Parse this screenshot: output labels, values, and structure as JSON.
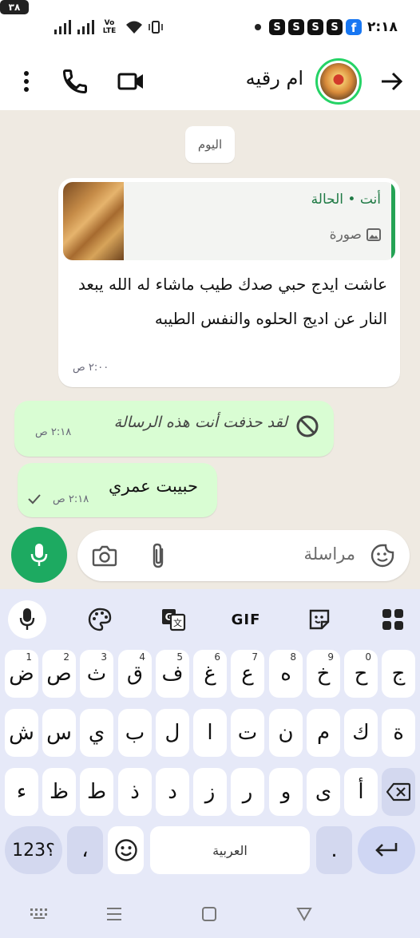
{
  "status_bar": {
    "battery": "٣٨",
    "network": "Vo LTE",
    "app_badges": [
      "S",
      "S",
      "S",
      "S"
    ],
    "facebook_badge": "f",
    "time": "٢:١٨"
  },
  "header": {
    "contact_name": "ام رقيه",
    "icons": [
      "back-arrow-icon",
      "video-call-icon",
      "voice-call-icon",
      "more-options-icon"
    ]
  },
  "chat": {
    "date_chip": "اليوم",
    "incoming": {
      "quote_title": "أنت • الحالة",
      "quote_subtitle": "صورة",
      "text": "عاشت ايدج حبي صدك طيب ماشاء له الله يبعد النار عن اديج الحلوه والنفس الطيبه",
      "time": "٢:٠٠ ص"
    },
    "deleted": {
      "text": "لقد حذفت أنت هذه الرسالة",
      "time": "٢:١٨ ص"
    },
    "outgoing": {
      "text": "حبيبت عمري",
      "time": "٢:١٨ ص"
    }
  },
  "composer": {
    "placeholder": "مراسلة"
  },
  "keyboard": {
    "toolbar": [
      "mic-icon",
      "palette-icon",
      "translate-icon",
      "GIF",
      "sticker-icon",
      "apps-grid-icon"
    ],
    "row1": [
      {
        "ch": "ض",
        "num": "1"
      },
      {
        "ch": "ص",
        "num": "2"
      },
      {
        "ch": "ث",
        "num": "3"
      },
      {
        "ch": "ق",
        "num": "4"
      },
      {
        "ch": "ف",
        "num": "5"
      },
      {
        "ch": "غ",
        "num": "6"
      },
      {
        "ch": "ع",
        "num": "7"
      },
      {
        "ch": "ه",
        "num": "8"
      },
      {
        "ch": "خ",
        "num": "9"
      },
      {
        "ch": "ح",
        "num": "0"
      },
      {
        "ch": "ج",
        "num": ""
      }
    ],
    "row2": [
      "ش",
      "س",
      "ي",
      "ب",
      "ل",
      "ا",
      "ت",
      "ن",
      "م",
      "ك",
      "ة"
    ],
    "row3": [
      "ء",
      "ظ",
      "ط",
      "ذ",
      "د",
      "ز",
      "ر",
      "و",
      "ى",
      "أ"
    ],
    "symbols_label": "؟123",
    "comma_label": "،",
    "space_label": "العربية",
    "period_label": "."
  }
}
